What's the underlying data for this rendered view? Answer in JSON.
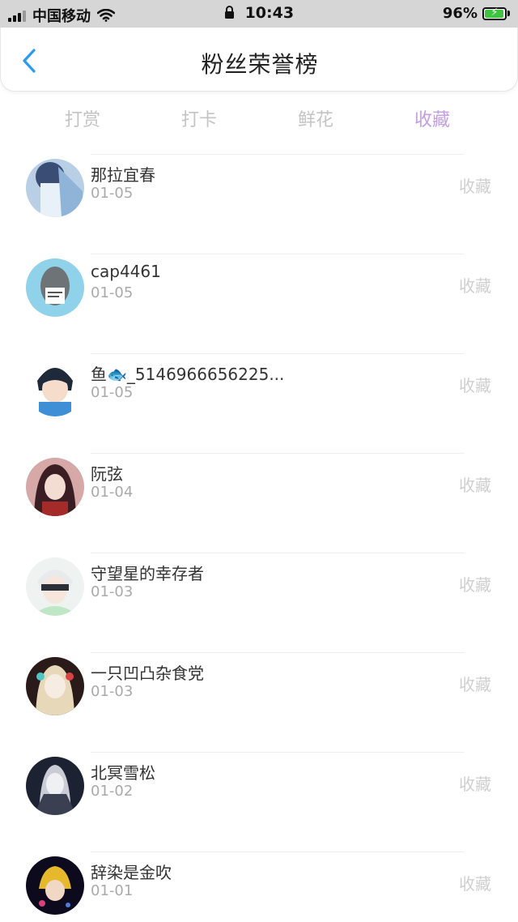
{
  "status_bar": {
    "carrier": "中国移动",
    "time": "10:43",
    "battery": "96%"
  },
  "header": {
    "title": "粉丝荣誉榜",
    "back_icon": "chevron-left-icon"
  },
  "tabs": [
    {
      "label": "打赏",
      "active": false
    },
    {
      "label": "打卡",
      "active": false
    },
    {
      "label": "鲜花",
      "active": false
    },
    {
      "label": "收藏",
      "active": true
    }
  ],
  "colors": {
    "accent": "#c49de6",
    "back": "#2a9bf0",
    "muted": "#cfcfcf"
  },
  "fans": [
    {
      "name": "那拉宜春",
      "date": "01-05",
      "action": "收藏"
    },
    {
      "name": "cap4461",
      "date": "01-05",
      "action": "收藏"
    },
    {
      "name": "鱼🐟_5146966656225...",
      "date": "01-05",
      "action": "收藏"
    },
    {
      "name": "阮弦",
      "date": "01-04",
      "action": "收藏"
    },
    {
      "name": "守望星的幸存者",
      "date": "01-03",
      "action": "收藏"
    },
    {
      "name": "一只凹凸杂食党",
      "date": "01-03",
      "action": "收藏"
    },
    {
      "name": "北冥雪松",
      "date": "01-02",
      "action": "收藏"
    },
    {
      "name": "辞染是金吹",
      "date": "01-01",
      "action": "收藏"
    }
  ]
}
